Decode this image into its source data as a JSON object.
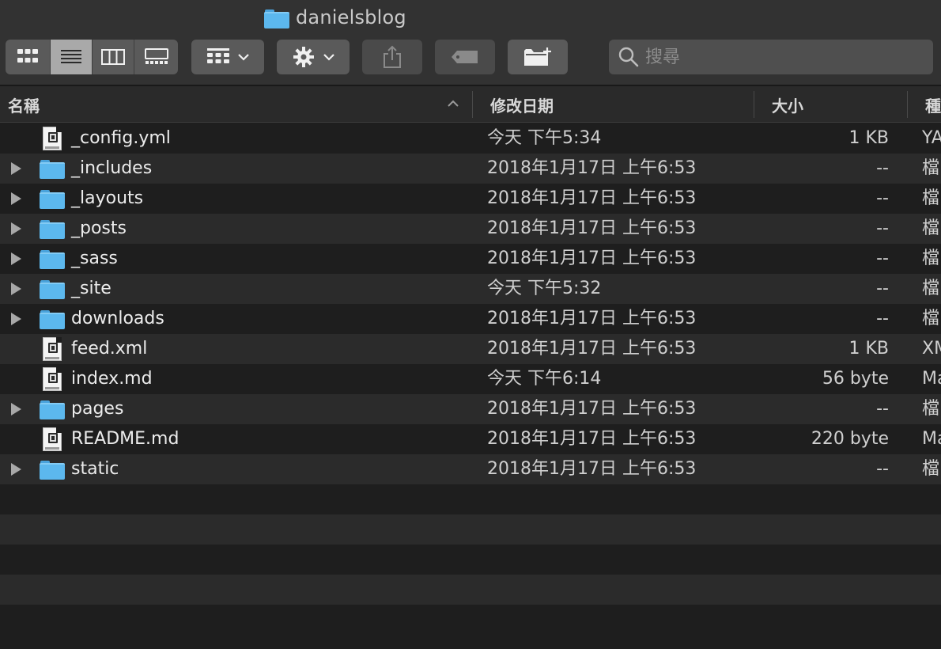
{
  "window": {
    "title": "danielsblog"
  },
  "toolbar": {
    "view_modes": [
      "icon-view-icon",
      "list-view-icon",
      "column-view-icon",
      "gallery-view-icon"
    ],
    "active_view": "list",
    "group_icon": "group-by-icon",
    "action_icon": "gear-icon",
    "share_icon": "share-icon",
    "tag_icon": "tag-icon",
    "new_folder_icon": "new-folder-icon",
    "search_placeholder": "搜尋"
  },
  "columns": {
    "name": "名稱",
    "date": "修改日期",
    "size": "大小",
    "kind": "種"
  },
  "files": [
    {
      "name": "_config.yml",
      "type": "file",
      "date": "今天 下午5:34",
      "size": "1 KB",
      "kind": "YA"
    },
    {
      "name": "_includes",
      "type": "folder",
      "date": "2018年1月17日 上午6:53",
      "size": "--",
      "kind": "檔"
    },
    {
      "name": "_layouts",
      "type": "folder",
      "date": "2018年1月17日 上午6:53",
      "size": "--",
      "kind": "檔"
    },
    {
      "name": "_posts",
      "type": "folder",
      "date": "2018年1月17日 上午6:53",
      "size": "--",
      "kind": "檔"
    },
    {
      "name": "_sass",
      "type": "folder",
      "date": "2018年1月17日 上午6:53",
      "size": "--",
      "kind": "檔"
    },
    {
      "name": "_site",
      "type": "folder",
      "date": "今天 下午5:32",
      "size": "--",
      "kind": "檔"
    },
    {
      "name": "downloads",
      "type": "folder",
      "date": "2018年1月17日 上午6:53",
      "size": "--",
      "kind": "檔"
    },
    {
      "name": "feed.xml",
      "type": "file",
      "date": "2018年1月17日 上午6:53",
      "size": "1 KB",
      "kind": "XM"
    },
    {
      "name": "index.md",
      "type": "file",
      "date": "今天 下午6:14",
      "size": "56 byte",
      "kind": "Ma"
    },
    {
      "name": "pages",
      "type": "folder",
      "date": "2018年1月17日 上午6:53",
      "size": "--",
      "kind": "檔"
    },
    {
      "name": "README.md",
      "type": "file",
      "date": "2018年1月17日 上午6:53",
      "size": "220 byte",
      "kind": "Ma"
    },
    {
      "name": "static",
      "type": "folder",
      "date": "2018年1月17日 上午6:53",
      "size": "--",
      "kind": "檔"
    }
  ],
  "colors": {
    "folder": "#5cb8ee",
    "background": "#1e1e1e",
    "stripe": "#2b2b2b",
    "toolbar": "#323232"
  }
}
